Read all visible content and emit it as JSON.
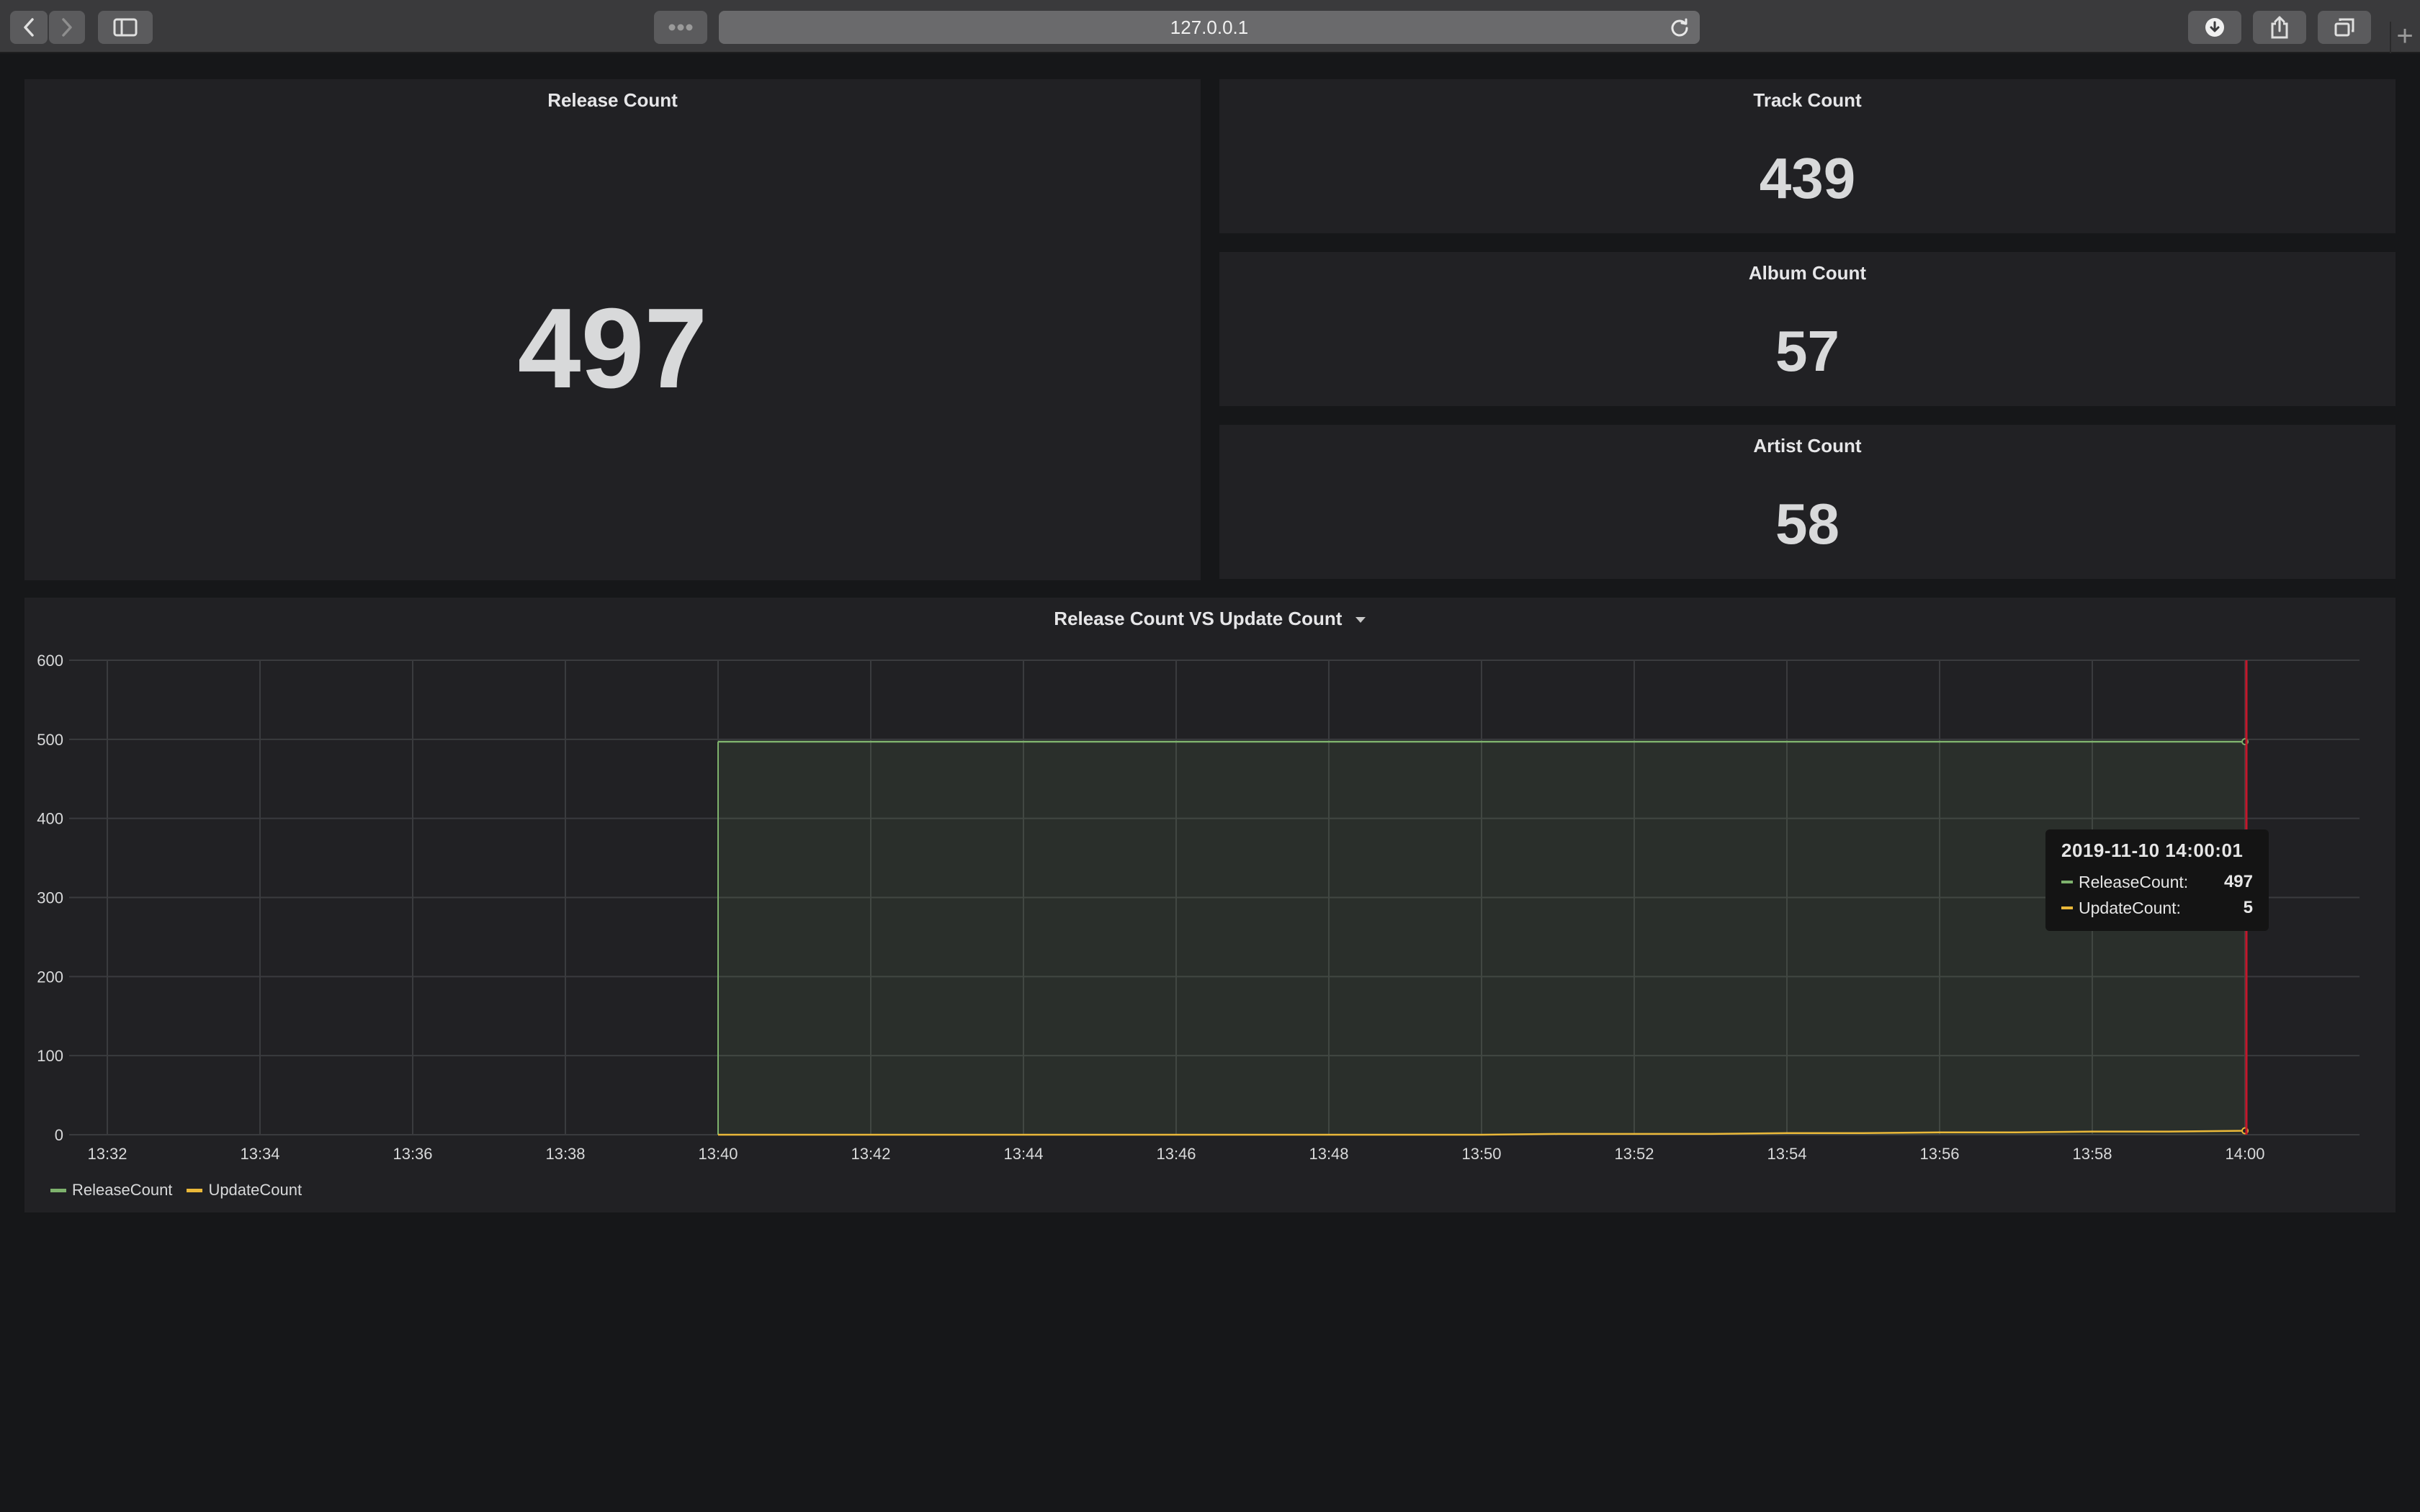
{
  "browser": {
    "url": "127.0.0.1",
    "new_tab_label": "+"
  },
  "stats": {
    "release": {
      "title": "Release Count",
      "value": "497"
    },
    "track": {
      "title": "Track Count",
      "value": "439"
    },
    "album": {
      "title": "Album Count",
      "value": "57"
    },
    "artist": {
      "title": "Artist Count",
      "value": "58"
    }
  },
  "graph": {
    "title": "Release Count VS Update Count",
    "tooltip": {
      "time": "2019-11-10 14:00:01",
      "rows": [
        {
          "name": "ReleaseCount:",
          "value": "497"
        },
        {
          "name": "UpdateCount:",
          "value": "5"
        }
      ]
    }
  },
  "chart_data": {
    "type": "area",
    "x": [
      "13:40",
      "13:41",
      "13:42",
      "13:43",
      "13:44",
      "13:45",
      "13:46",
      "13:47",
      "13:48",
      "13:49",
      "13:50",
      "13:51",
      "13:52",
      "13:53",
      "13:54",
      "13:55",
      "13:56",
      "13:57",
      "13:58",
      "13:59",
      "14:00"
    ],
    "x_ticks": [
      "13:32",
      "13:34",
      "13:36",
      "13:38",
      "13:40",
      "13:42",
      "13:44",
      "13:46",
      "13:48",
      "13:50",
      "13:52",
      "13:54",
      "13:56",
      "13:58",
      "14:00"
    ],
    "y_ticks": [
      0,
      100,
      200,
      300,
      400,
      500,
      600
    ],
    "ylim": [
      0,
      600
    ],
    "xlim": [
      "13:31:30",
      "14:01:30"
    ],
    "grid": true,
    "legend_position": "bottom-left",
    "series": [
      {
        "name": "ReleaseCount",
        "color": "#7eb26d",
        "values": [
          497,
          497,
          497,
          497,
          497,
          497,
          497,
          497,
          497,
          497,
          497,
          497,
          497,
          497,
          497,
          497,
          497,
          497,
          497,
          497,
          497
        ]
      },
      {
        "name": "UpdateCount",
        "color": "#eab839",
        "values": [
          0,
          0,
          0,
          0,
          0,
          0,
          0,
          0,
          0,
          0,
          0,
          1,
          1,
          1,
          2,
          2,
          3,
          3,
          4,
          4,
          5
        ]
      }
    ]
  }
}
